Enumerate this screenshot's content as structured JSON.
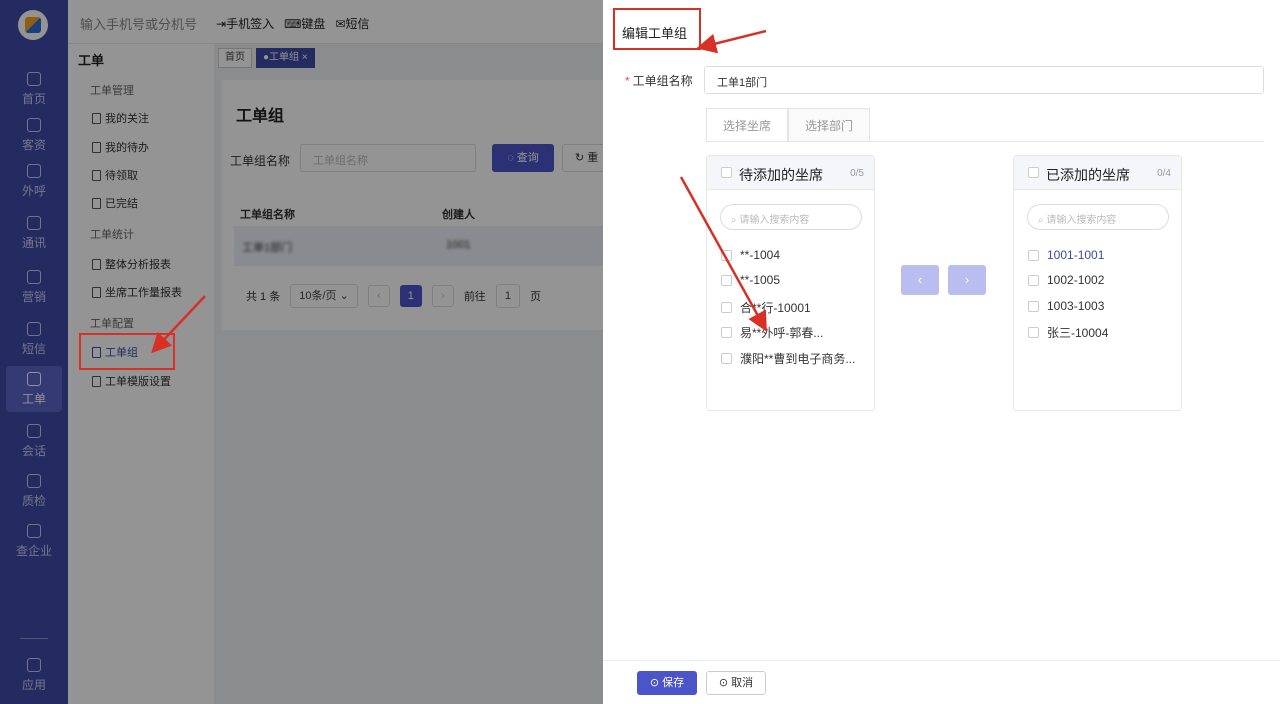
{
  "rail": {
    "items": [
      {
        "label": "首页",
        "icon": "home-icon"
      },
      {
        "label": "客资",
        "icon": "customer-icon"
      },
      {
        "label": "外呼",
        "icon": "phone-icon"
      },
      {
        "label": "通讯",
        "icon": "contacts-icon"
      },
      {
        "label": "营销",
        "icon": "marketing-icon"
      },
      {
        "label": "短信",
        "icon": "sms-icon"
      },
      {
        "label": "工单",
        "icon": "clipboard-icon"
      },
      {
        "label": "会话",
        "icon": "chat-icon"
      },
      {
        "label": "质检",
        "icon": "quality-icon"
      },
      {
        "label": "查企业",
        "icon": "building-icon"
      },
      {
        "label": "应用",
        "icon": "apps-icon"
      }
    ]
  },
  "topbar": {
    "dial_placeholder": "输入手机号或分机号",
    "phone_signin": "手机签入",
    "keyboard": "键盘",
    "sms": "短信"
  },
  "subnav": {
    "title": "工单",
    "group1": "工单管理",
    "my_follow": "我的关注",
    "my_todo": "我的待办",
    "to_claim": "待领取",
    "done": "已完结",
    "group2": "工单统计",
    "overall_report": "整体分析报表",
    "agent_report": "坐席工作量报表",
    "group3": "工单配置",
    "ticket_group": "工单组",
    "template_settings": "工单模版设置"
  },
  "main": {
    "crumb_home": "首页",
    "crumb_active": "●工单组 ×",
    "title": "工单组",
    "filter_label": "工单组名称",
    "filter_placeholder": "工单组名称",
    "query": "◌ 查询",
    "reset": "↻ 重置",
    "col_name": "工单组名称",
    "col_creator": "创建人",
    "row_name": "工单1部门",
    "row_creator": "1001",
    "total": "共 1 条",
    "page_size": "10条/页",
    "page": "1",
    "goto": "前往",
    "goto_page": "1",
    "page_unit": "页"
  },
  "drawer": {
    "title": "编辑工单组",
    "name_label": "工单组名称",
    "name_value": "工单1部门",
    "tab_agents": "选择坐席",
    "tab_departments": "选择部门",
    "left_title": "待添加的坐席",
    "left_count": "0/5",
    "right_title": "已添加的坐席",
    "right_count": "0/4",
    "search_placeholder": "请输入搜索内容",
    "left_items": [
      "**-1004",
      "**-1005",
      "合**行-10001",
      "易**外呼-郭春...",
      "濮阳**曹到电子商务..."
    ],
    "right_items": [
      "1001-1001",
      "1002-1002",
      "1003-1003",
      "张三-10004"
    ],
    "to_left": "‹",
    "to_right": "›",
    "save": "保存",
    "cancel": "取消"
  },
  "colors": {
    "primary": "#4b55c9",
    "rail": "#3d4aa8",
    "annotation": "#d93025"
  }
}
